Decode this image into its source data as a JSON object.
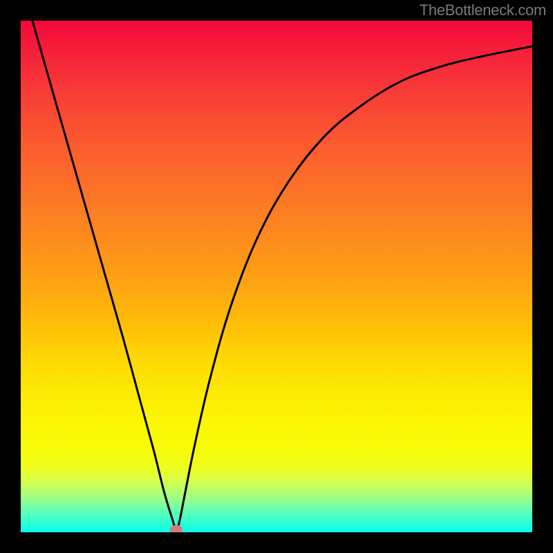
{
  "watermark": "TheBottleneck.com",
  "chart_data": {
    "type": "line",
    "title": "",
    "xlabel": "",
    "ylabel": "",
    "xlim": [
      0,
      100
    ],
    "ylim": [
      0,
      100
    ],
    "grid": false,
    "legend": false,
    "series": [
      {
        "name": "bottleneck-curve",
        "x": [
          0,
          4,
          8,
          12,
          16,
          20,
          23,
          26,
          28,
          29.5,
          30.4,
          31,
          32,
          34,
          37,
          41,
          46,
          52,
          59,
          66,
          74,
          82,
          90,
          100
        ],
        "y": [
          108,
          94,
          80,
          66,
          52,
          38,
          27,
          16,
          8,
          3,
          0.5,
          2,
          7,
          17,
          30,
          44,
          57,
          68,
          77,
          83,
          88,
          91,
          93,
          95
        ]
      }
    ],
    "marker": {
      "x": 30.4,
      "y": 0.5
    },
    "background": {
      "type": "vertical-gradient",
      "stops": [
        {
          "pos": 0.0,
          "color": "#f4093a"
        },
        {
          "pos": 0.5,
          "color": "#fea010"
        },
        {
          "pos": 0.8,
          "color": "#fbf703"
        },
        {
          "pos": 0.92,
          "color": "#b0fe73"
        },
        {
          "pos": 1.0,
          "color": "#05fff0"
        }
      ]
    }
  }
}
